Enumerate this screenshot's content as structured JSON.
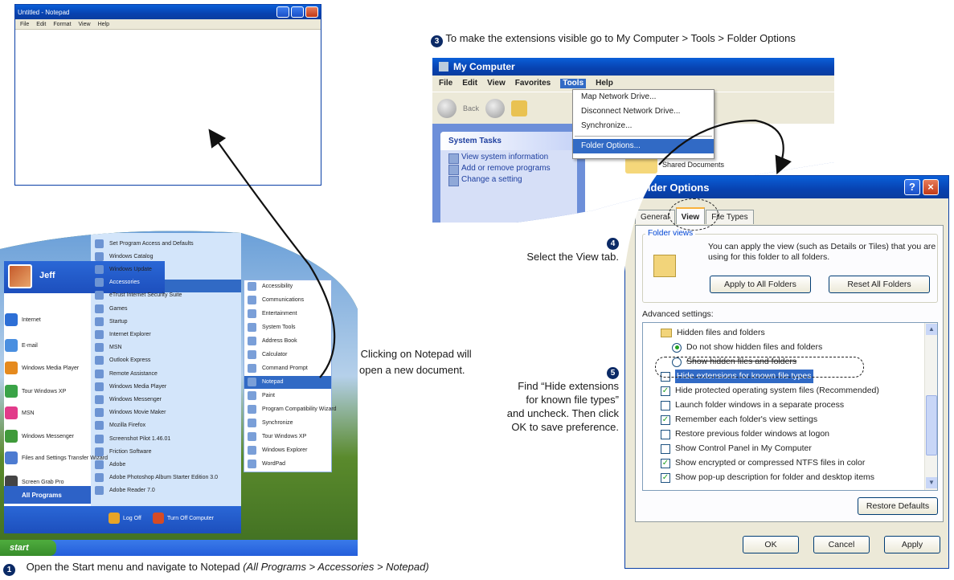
{
  "notepad": {
    "title": "Untitled - Notepad",
    "menu": [
      "File",
      "Edit",
      "Format",
      "View",
      "Help"
    ]
  },
  "steps": {
    "step1": {
      "num": "1",
      "text": "Open the Start menu and navigate to Notepad ",
      "italic": "(All Programs > Accessories > Notepad)"
    },
    "step2": {
      "num": "2",
      "line1": "Clicking on Notepad will",
      "line2": "open a new document."
    },
    "step3": {
      "num": "3",
      "text": "To make the extensions visible go to My Computer > Tools > Folder Options"
    },
    "step4": {
      "num": "4",
      "text": "Select the View tab."
    },
    "step5": {
      "num": "5",
      "lines": [
        "Find “Hide extensions",
        "for known file types”",
        "and uncheck. Then click",
        "OK to save preference."
      ]
    }
  },
  "mycomputer": {
    "title": "My Computer",
    "menu": [
      "File",
      "Edit",
      "View",
      "Favorites",
      "Tools",
      "Help"
    ],
    "back": "Back",
    "content_label": "omputer",
    "shared": "Shared Documents",
    "tasks_header": "System Tasks",
    "tasks": [
      "View system information",
      "Add or remove programs",
      "Change a setting"
    ],
    "tools_menu": [
      "Map Network Drive...",
      "Disconnect Network Drive...",
      "Synchronize...",
      "Folder Options..."
    ]
  },
  "folder_options": {
    "title": "Folder Options",
    "tabs": [
      "General",
      "View",
      "File Types"
    ],
    "folder_views_label": "Folder views",
    "folder_views_text": "You can apply the view (such as Details or Tiles) that you are using for this folder to all folders.",
    "apply_all": "Apply to All Folders",
    "reset_all": "Reset All Folders",
    "advanced_label": "Advanced settings:",
    "settings": [
      {
        "kind": "folder",
        "label": "Hidden files and folders"
      },
      {
        "kind": "radio",
        "checked": true,
        "label": "Do not show hidden files and folders"
      },
      {
        "kind": "radio",
        "checked": false,
        "label": "Show hidden files and folders"
      },
      {
        "kind": "check",
        "checked": false,
        "label": "Hide extensions for known file types"
      },
      {
        "kind": "check",
        "checked": true,
        "label": "Hide protected operating system files (Recommended)"
      },
      {
        "kind": "check",
        "checked": false,
        "label": "Launch folder windows in a separate process"
      },
      {
        "kind": "check",
        "checked": true,
        "label": "Remember each folder's view settings"
      },
      {
        "kind": "check",
        "checked": false,
        "label": "Restore previous folder windows at logon"
      },
      {
        "kind": "check",
        "checked": false,
        "label": "Show Control Panel in My Computer"
      },
      {
        "kind": "check",
        "checked": true,
        "label": "Show encrypted or compressed NTFS files in color"
      },
      {
        "kind": "check",
        "checked": true,
        "label": "Show pop-up description for folder and desktop items"
      }
    ],
    "restore_defaults": "Restore Defaults",
    "ok": "OK",
    "cancel": "Cancel",
    "apply": "Apply"
  },
  "startmenu": {
    "user": "Jeff",
    "pinned": [
      {
        "label": "Internet",
        "color": "#2d6fd6"
      },
      {
        "label": "E-mail",
        "color": "#4a8fe0"
      },
      {
        "label": "Windows Media Player",
        "color": "#e58a1e"
      },
      {
        "label": "Tour Windows XP",
        "color": "#3aa347"
      },
      {
        "label": "MSN",
        "color": "#e23b8a"
      },
      {
        "label": "Windows Messenger",
        "color": "#3f9a3a"
      },
      {
        "label": "Files and Settings Transfer Wizard",
        "color": "#4d7bd1"
      },
      {
        "label": "Screen Grab Pro",
        "color": "#444444"
      }
    ],
    "programs": [
      "Set Program Access and Defaults",
      "Windows Catalog",
      "Windows Update",
      "Accessories",
      "eTrust Internet Security Suite",
      "Games",
      "Startup",
      "Internet Explorer",
      "MSN",
      "Outlook Express",
      "Remote Assistance",
      "Windows Media Player",
      "Windows Messenger",
      "Windows Movie Maker",
      "Mozilla Firefox",
      "Screenshot Pilot 1.46.01",
      "Friction Software",
      "Adobe",
      "Adobe Photoshop Album Starter Edition 3.0",
      "Adobe Reader 7.0"
    ],
    "accessories": [
      "Accessibility",
      "Communications",
      "Entertainment",
      "System Tools",
      "Address Book",
      "Calculator",
      "Command Prompt",
      "Notepad",
      "Paint",
      "Program Compatibility Wizard",
      "Synchronize",
      "Tour Windows XP",
      "Windows Explorer",
      "WordPad"
    ],
    "all_programs": "All Programs",
    "log_off": "Log Off",
    "turn_off": "Turn Off Computer",
    "start": "start"
  }
}
